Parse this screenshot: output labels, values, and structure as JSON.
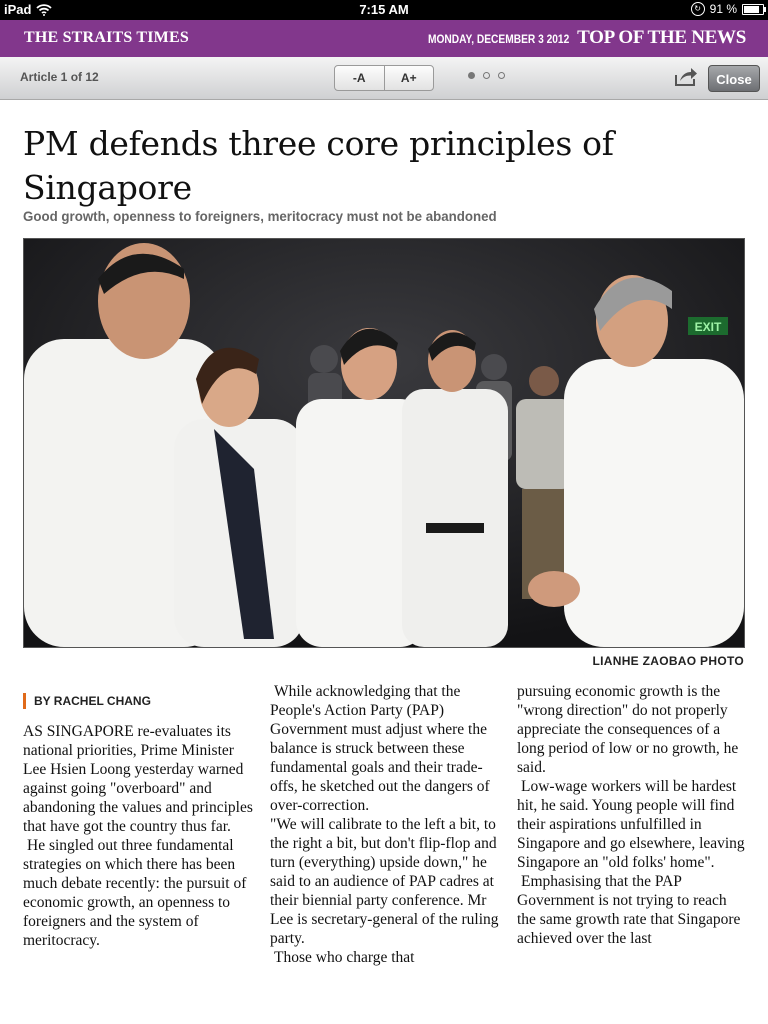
{
  "status_bar": {
    "device": "iPad",
    "time": "7:15 AM",
    "battery": "91 %",
    "battery_level": 0.91
  },
  "masthead": {
    "paper_name": "THE STRAITS TIMES",
    "date": "MONDAY, DECEMBER 3 2012",
    "section": "TOP OF THE NEWS",
    "color": "#82378c"
  },
  "toolbar": {
    "article_count": "Article 1 of 12",
    "font_decrease": "-A",
    "font_increase": "A+",
    "page_dots": 3,
    "active_dot": 1,
    "close_label": "Close"
  },
  "article": {
    "headline": "PM defends three core principles of Singapore",
    "subhead": "Good growth, openness to foreigners, meritocracy must not be abandoned",
    "photo_credit": "LIANHE ZAOBAO PHOTO",
    "byline": "BY RACHEL CHANG",
    "col1": [
      "AS SINGAPORE re-evaluates its national priorities, Prime Minister Lee Hsien Loong yesterday warned against going \"overboard\" and abandoning the values and principles that have got the country thus far.",
      "He singled out three fundamental strategies on which there has been much debate recently: the pursuit of economic growth, an openness to foreigners and the system of meritocracy."
    ],
    "col2": [
      "While acknowledging that the People's Action Party (PAP) Government must adjust where the balance is struck between these fundamental goals and their trade-offs, he sketched out the dangers of over-correction.",
      "\"We will calibrate to the left a bit, to the right a bit, but don't flip-flop and turn (everything) upside down,\" he said to an audience of PAP cadres at their biennial party conference. Mr Lee is secretary-general of the ruling party.",
      "Those who charge that"
    ],
    "col3": [
      "pursuing economic growth is the \"wrong direction\" do not properly appreciate the consequences of a long period of low or no growth, he said.",
      "Low-wage workers will be hardest hit, he said. Young people will find their aspirations unfulfilled in Singapore and go elsewhere, leaving Singapore an \"old folks' home\".",
      "Emphasising that the PAP Government is not trying to reach the same growth rate that Singapore achieved over the last"
    ]
  },
  "photo_elements": {
    "exit_sign": "EXIT"
  }
}
